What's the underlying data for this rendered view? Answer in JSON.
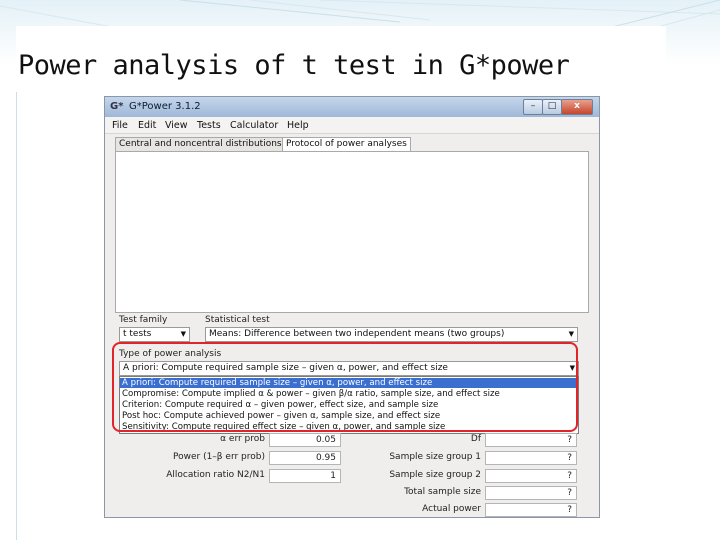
{
  "slide": {
    "title": "Power analysis of t test in G*power"
  },
  "window": {
    "icon": "G*",
    "title": "G*Power 3.1.2",
    "controls": {
      "minimize": "–",
      "maximize": "□",
      "close": "x"
    }
  },
  "menu": [
    "File",
    "Edit",
    "View",
    "Tests",
    "Calculator",
    "Help"
  ],
  "tabs": [
    "Central and noncentral distributions",
    "Protocol of power analyses"
  ],
  "test_family": {
    "label": "Test family",
    "value": "t tests"
  },
  "statistical_test": {
    "label": "Statistical test",
    "value": "Means: Difference between two independent means (two groups)"
  },
  "power_analysis": {
    "label": "Type of power analysis",
    "value": "A priori: Compute required sample size – given α, power, and effect size",
    "options": [
      "A priori: Compute required sample size – given α, power, and effect size",
      "Compromise: Compute implied α & power – given β/α ratio, sample size, and effect size",
      "Criterion: Compute required α – given power, effect size, and sample size",
      "Post hoc: Compute achieved power – given α, sample size, and effect size",
      "Sensitivity: Compute required effect size – given α, power, and sample size"
    ]
  },
  "input_params": [
    {
      "label": "α err prob",
      "value": "0.05"
    },
    {
      "label": "Power (1–β err prob)",
      "value": "0.95"
    },
    {
      "label": "Allocation ratio N2/N1",
      "value": "1"
    }
  ],
  "output_params": [
    {
      "label": "Df",
      "value": "?"
    },
    {
      "label": "Sample size group 1",
      "value": "?"
    },
    {
      "label": "Sample size group 2",
      "value": "?"
    },
    {
      "label": "Total sample size",
      "value": "?"
    },
    {
      "label": "Actual power",
      "value": "?"
    }
  ],
  "colors": {
    "highlight": "#e0242a",
    "selection": "#3a6fd0",
    "titlebar": "#9fb8d8"
  }
}
